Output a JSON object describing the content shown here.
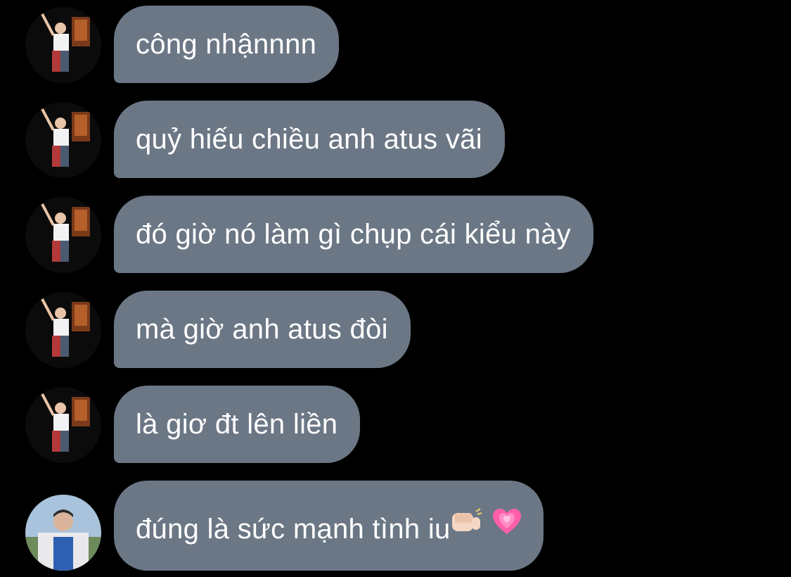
{
  "messages": [
    {
      "text": "công nhậnnnn",
      "avatar": "friend-avatar"
    },
    {
      "text": "quỷ hiếu chiều anh atus vãi",
      "avatar": "friend-avatar"
    },
    {
      "text": "đó giờ nó làm gì chụp cái kiểu này",
      "avatar": "friend-avatar"
    },
    {
      "text": "mà giờ anh atus đòi",
      "avatar": "friend-avatar"
    },
    {
      "text": "là giơ đt lên liền",
      "avatar": "friend-avatar"
    },
    {
      "text": "đúng là sức mạnh tình iu",
      "avatar": "user-avatar",
      "emojis": [
        "facepunch-emoji",
        "growing-heart-emoji"
      ]
    }
  ],
  "colors": {
    "background": "#000000",
    "bubble": "#6b7785",
    "text": "#ffffff",
    "heart": "#ff5fa8"
  }
}
